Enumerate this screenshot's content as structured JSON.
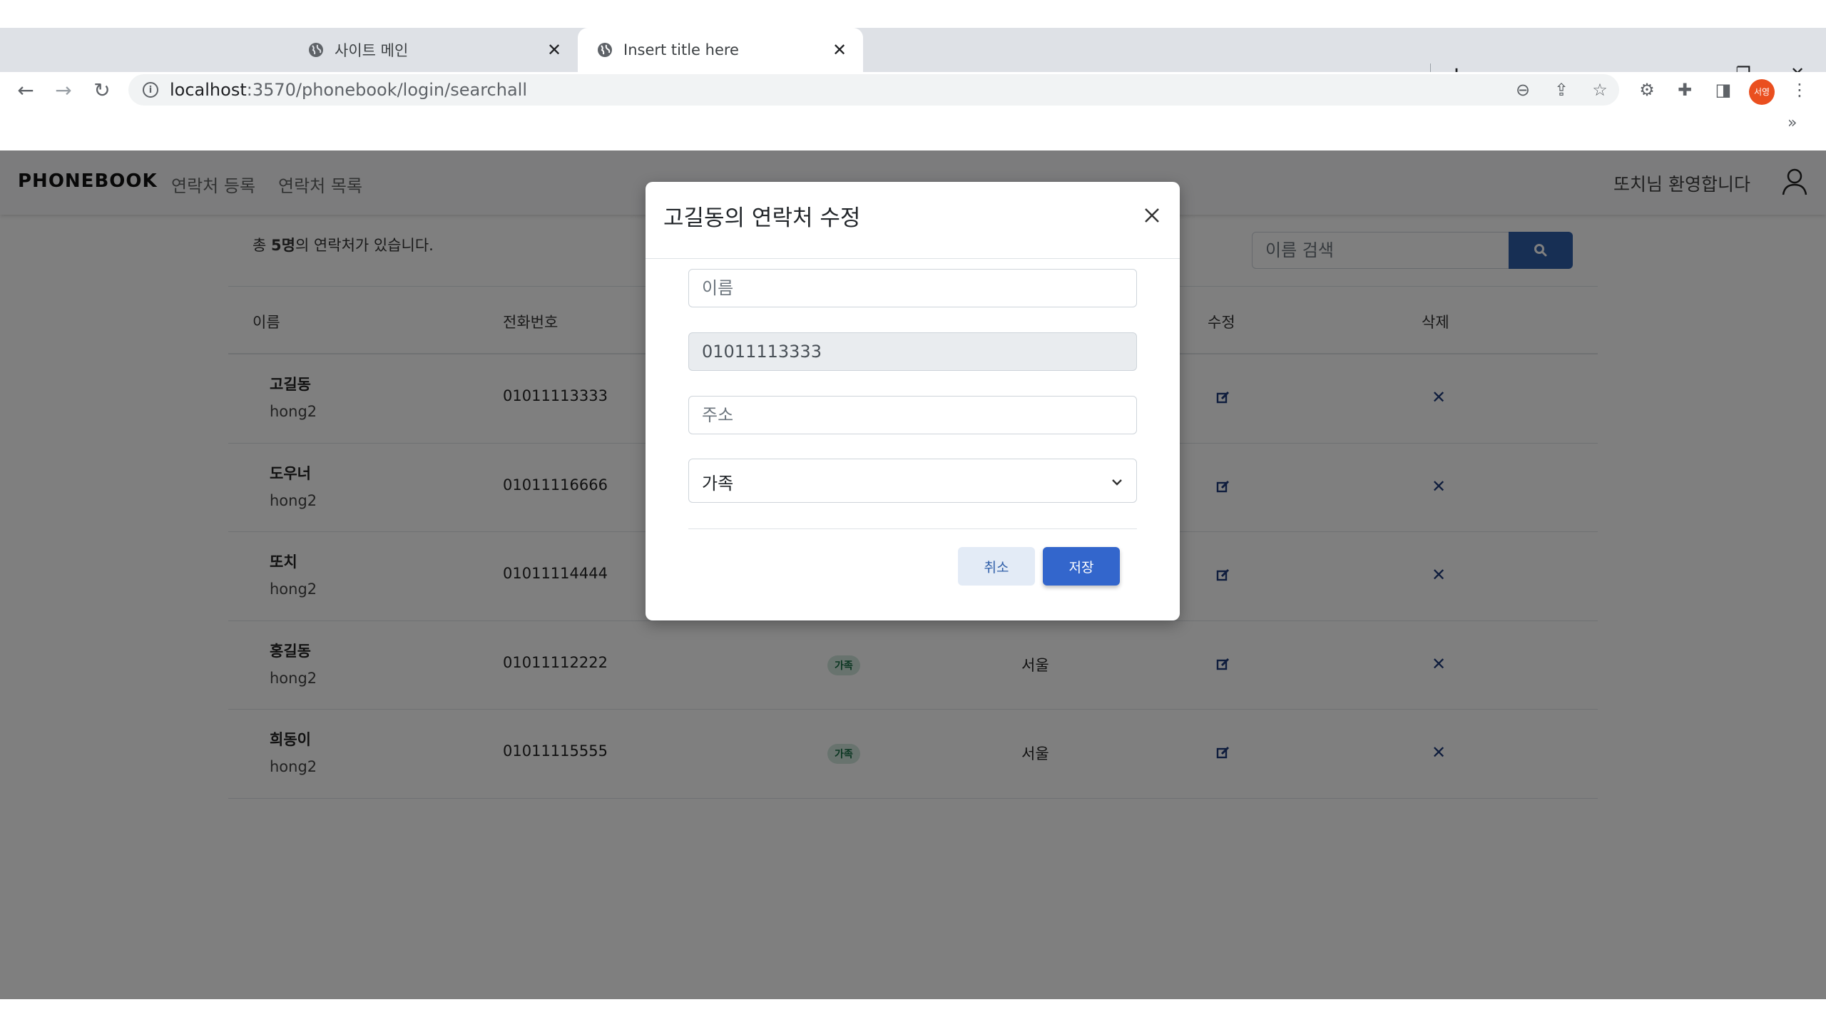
{
  "browser": {
    "tabs": [
      {
        "title": "사이트 메인",
        "active": false
      },
      {
        "title": "Insert title here",
        "active": true
      }
    ],
    "new_tab_label": "+",
    "url_host": "localhost",
    "url_path": ":3570/phonebook/login/searchall",
    "profile_initials": "서영",
    "bookmarks_overflow": "»"
  },
  "app": {
    "brand": "PHONEBOOK",
    "nav_links": [
      "연락처 등록",
      "연락처 목록"
    ],
    "welcome": "또치님 환영합니다"
  },
  "list": {
    "count_prefix": "총 ",
    "count_value": "5명",
    "count_suffix": "의 연락처가 있습니다.",
    "search_placeholder": "이름 검색",
    "headers": {
      "name": "이름",
      "phone": "전화번호",
      "edit": "수정",
      "delete": "삭제"
    },
    "rows": [
      {
        "name": "고길동",
        "owner": "hong2",
        "phone": "01011113333",
        "group": "",
        "address": ""
      },
      {
        "name": "도우너",
        "owner": "hong2",
        "phone": "01011116666",
        "group": "",
        "address": ""
      },
      {
        "name": "또치",
        "owner": "hong2",
        "phone": "01011114444",
        "group": "",
        "address": ""
      },
      {
        "name": "홍길동",
        "owner": "hong2",
        "phone": "01011112222",
        "group": "가족",
        "address": "서울"
      },
      {
        "name": "희동이",
        "owner": "hong2",
        "phone": "01011115555",
        "group": "가족",
        "address": "서울"
      }
    ]
  },
  "modal": {
    "title": "고길동의 연락처 수정",
    "name_placeholder": "이름",
    "phone_value": "01011113333",
    "address_placeholder": "주소",
    "group_selected": "가족",
    "cancel_label": "취소",
    "save_label": "저장"
  },
  "colors": {
    "primary": "#3366cc",
    "badge_bg": "#d1e7dd",
    "badge_text": "#146c43",
    "delete_x": "#1e3a7a"
  }
}
